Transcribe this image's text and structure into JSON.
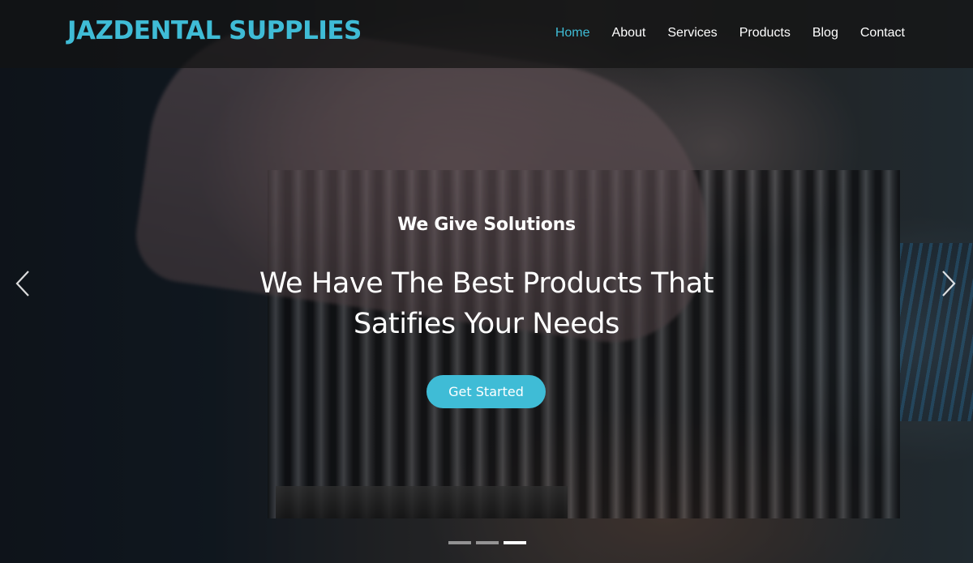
{
  "brand": {
    "name": "JAZDENTAL SUPPLIES",
    "color": "#3fbcd6"
  },
  "nav": {
    "items": [
      {
        "label": "Home",
        "active": true
      },
      {
        "label": "About",
        "active": false
      },
      {
        "label": "Services",
        "active": false
      },
      {
        "label": "Products",
        "active": false
      },
      {
        "label": "Blog",
        "active": false
      },
      {
        "label": "Contact",
        "active": false
      }
    ]
  },
  "hero": {
    "kicker": "We Give Solutions",
    "headline": "We Have The Best Products That Satifies Your Needs",
    "cta_label": "Get Started",
    "prev_icon": "chevron-left-icon",
    "next_icon": "chevron-right-icon",
    "slides": {
      "count": 3,
      "active_index": 2
    }
  }
}
